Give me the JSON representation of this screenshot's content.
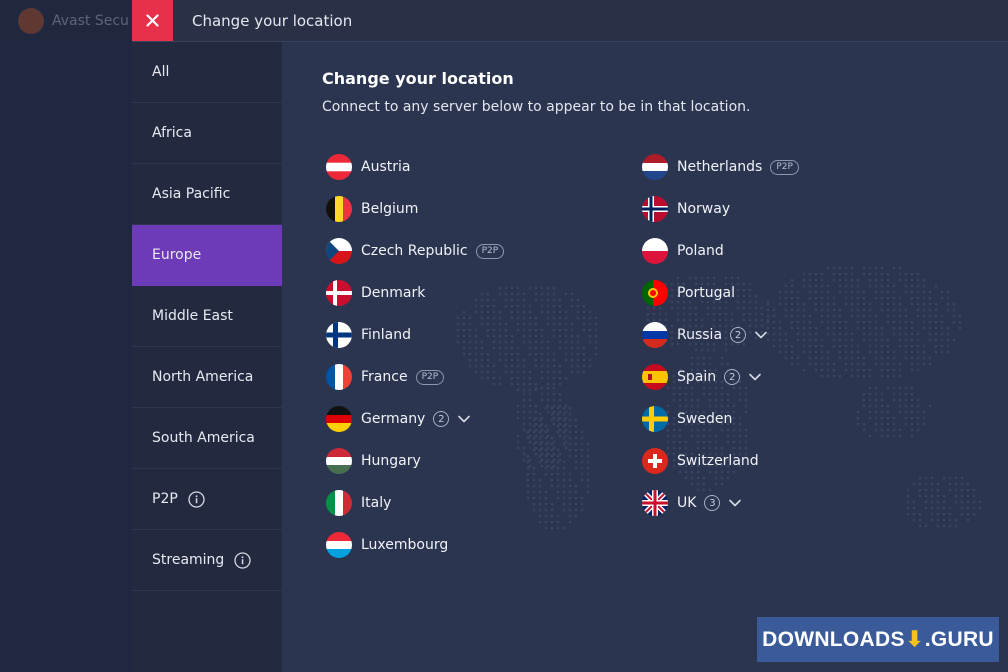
{
  "background_app": {
    "title": "Avast Secu"
  },
  "window": {
    "title": "Change your location"
  },
  "sidebar": {
    "items": [
      {
        "label": "All",
        "active": false,
        "info": false
      },
      {
        "label": "Africa",
        "active": false,
        "info": false
      },
      {
        "label": "Asia Pacific",
        "active": false,
        "info": false
      },
      {
        "label": "Europe",
        "active": true,
        "info": false
      },
      {
        "label": "Middle East",
        "active": false,
        "info": false
      },
      {
        "label": "North America",
        "active": false,
        "info": false
      },
      {
        "label": "South America",
        "active": false,
        "info": false
      },
      {
        "label": "P2P",
        "active": false,
        "info": true
      },
      {
        "label": "Streaming",
        "active": false,
        "info": true
      }
    ]
  },
  "content": {
    "title": "Change your location",
    "subtitle": "Connect to any server below to appear to be in that location."
  },
  "locations": {
    "left": [
      {
        "name": "Austria",
        "flag": "austria-flag"
      },
      {
        "name": "Belgium",
        "flag": "belgium-flag"
      },
      {
        "name": "Czech Republic",
        "flag": "czech-flag",
        "badge": "P2P"
      },
      {
        "name": "Denmark",
        "flag": "denmark-flag"
      },
      {
        "name": "Finland",
        "flag": "finland-flag"
      },
      {
        "name": "France",
        "flag": "france-flag",
        "badge": "P2P"
      },
      {
        "name": "Germany",
        "flag": "germany-flag",
        "count": "2"
      },
      {
        "name": "Hungary",
        "flag": "hungary-flag"
      },
      {
        "name": "Italy",
        "flag": "italy-flag"
      },
      {
        "name": "Luxembourg",
        "flag": "luxembourg-flag"
      }
    ],
    "right": [
      {
        "name": "Netherlands",
        "flag": "netherlands-flag",
        "badge": "P2P"
      },
      {
        "name": "Norway",
        "flag": "norway-flag"
      },
      {
        "name": "Poland",
        "flag": "poland-flag"
      },
      {
        "name": "Portugal",
        "flag": "portugal-flag"
      },
      {
        "name": "Russia",
        "flag": "russia-flag",
        "count": "2"
      },
      {
        "name": "Spain",
        "flag": "spain-flag",
        "count": "2"
      },
      {
        "name": "Sweden",
        "flag": "sweden-flag"
      },
      {
        "name": "Switzerland",
        "flag": "switzerland-flag"
      },
      {
        "name": "UK",
        "flag": "uk-flag",
        "count": "3"
      }
    ]
  },
  "watermark": {
    "left": "DOWNLOADS",
    "right": ".GURU"
  },
  "colors": {
    "accent": "#6d3ab8",
    "close": "#e8304a",
    "panel": "#2b3550",
    "sidebar": "#232a40"
  }
}
